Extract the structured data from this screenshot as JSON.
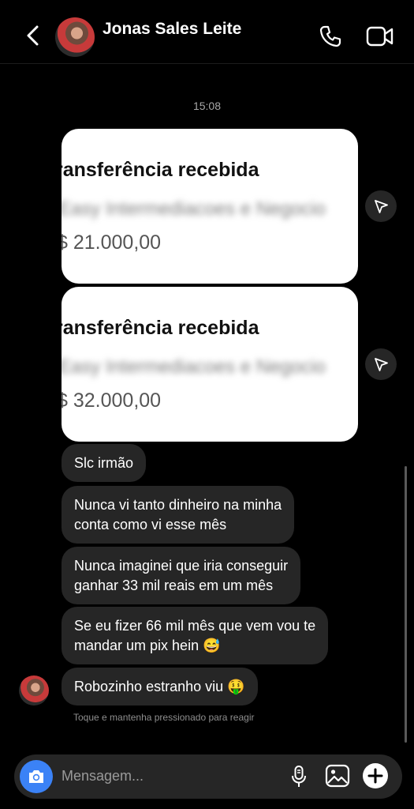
{
  "header": {
    "contact_name": "Jonas Sales Leite"
  },
  "timestamp": "15:08",
  "cards": [
    {
      "title": "ransferência recebida",
      "blurred_text": "Easy Intermediacoes e Negocio",
      "amount": "$ 21.000,00"
    },
    {
      "title": "ransferência recebida",
      "blurred_text": "Easy Intermediacoes e Negocio",
      "amount": "$ 32.000,00"
    }
  ],
  "messages": [
    {
      "text": "Slc irmão"
    },
    {
      "line1": "Nunca vi tanto dinheiro na minha",
      "line2": "conta como vi esse mês"
    },
    {
      "line1": "Nunca imaginei que iria conseguir",
      "line2": "ganhar 33 mil reais em um mês"
    },
    {
      "line1": "Se eu fizer 66 mil mês que vem vou te",
      "line2": "mandar um pix hein 😅"
    },
    {
      "text": "Robozinho estranho viu 🤑"
    }
  ],
  "reaction_hint": "Toque e mantenha pressionado para reagir",
  "composer": {
    "placeholder": "Mensagem..."
  },
  "colors": {
    "background": "#000000",
    "bubble": "#262626",
    "camera_button": "#3b82f6"
  }
}
